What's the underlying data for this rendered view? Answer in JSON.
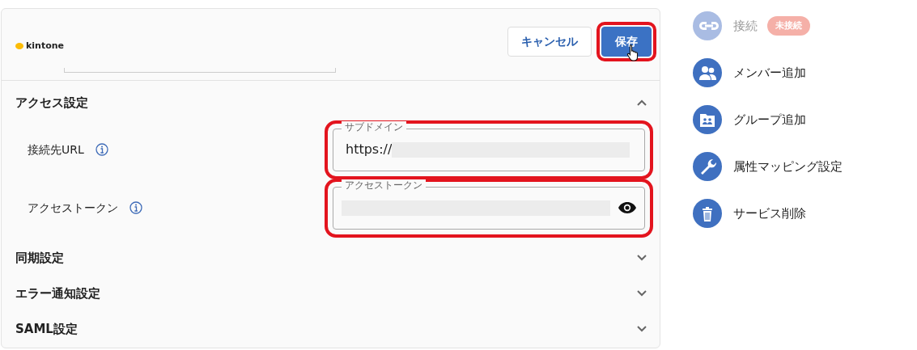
{
  "header": {
    "logo": "kintone",
    "buttons": [
      {
        "label": "キャンセル",
        "kind": "outline",
        "highlighted": false
      },
      {
        "label": "保存",
        "kind": "primary",
        "highlighted": true
      }
    ]
  },
  "sections": [
    {
      "title": "アクセス設定",
      "expanded": true,
      "fields": [
        {
          "label": "接続先URL",
          "floating_label": "サブドメイン",
          "value": "https://",
          "masked": true,
          "highlighted": true
        },
        {
          "label": "アクセストークン",
          "floating_label": "アクセストークン",
          "masked": true,
          "reveal": true,
          "highlighted": true
        }
      ]
    },
    {
      "title": "同期設定",
      "expanded": false
    },
    {
      "title": "エラー通知設定",
      "expanded": false
    },
    {
      "title": "SAML設定",
      "expanded": false
    }
  ],
  "side_menu": [
    {
      "label": "接続",
      "kind": "link",
      "disabled": true,
      "badge": "未接続"
    },
    {
      "label": "メンバー追加",
      "kind": "members",
      "disabled": false
    },
    {
      "label": "グループ追加",
      "kind": "group",
      "disabled": false
    },
    {
      "label": "属性マッピング設定",
      "kind": "wrench",
      "disabled": false
    },
    {
      "label": "サービス削除",
      "kind": "trash",
      "disabled": false
    }
  ]
}
